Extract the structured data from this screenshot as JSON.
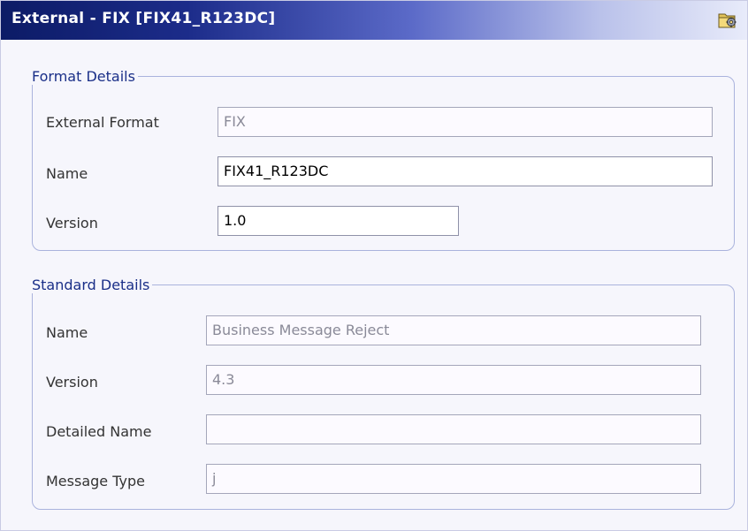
{
  "window": {
    "title": "External - FIX [FIX41_R123DC]",
    "title_icon": "folder-gear-icon"
  },
  "format_details": {
    "legend": "Format Details",
    "external_format": {
      "label": "External Format",
      "value": "FIX"
    },
    "name": {
      "label": "Name",
      "value": "FIX41_R123DC"
    },
    "version": {
      "label": "Version",
      "value": "1.0"
    }
  },
  "standard_details": {
    "legend": "Standard Details",
    "name": {
      "label": "Name",
      "value": "Business Message Reject"
    },
    "version": {
      "label": "Version",
      "value": "4.3"
    },
    "detailed_name": {
      "label": "Detailed Name",
      "value": ""
    },
    "message_type": {
      "label": "Message Type",
      "value": "j"
    }
  },
  "colors": {
    "title_bar_dark": "#0c1b66",
    "legend_text": "#1a2f88",
    "group_border": "#aab3dd"
  }
}
